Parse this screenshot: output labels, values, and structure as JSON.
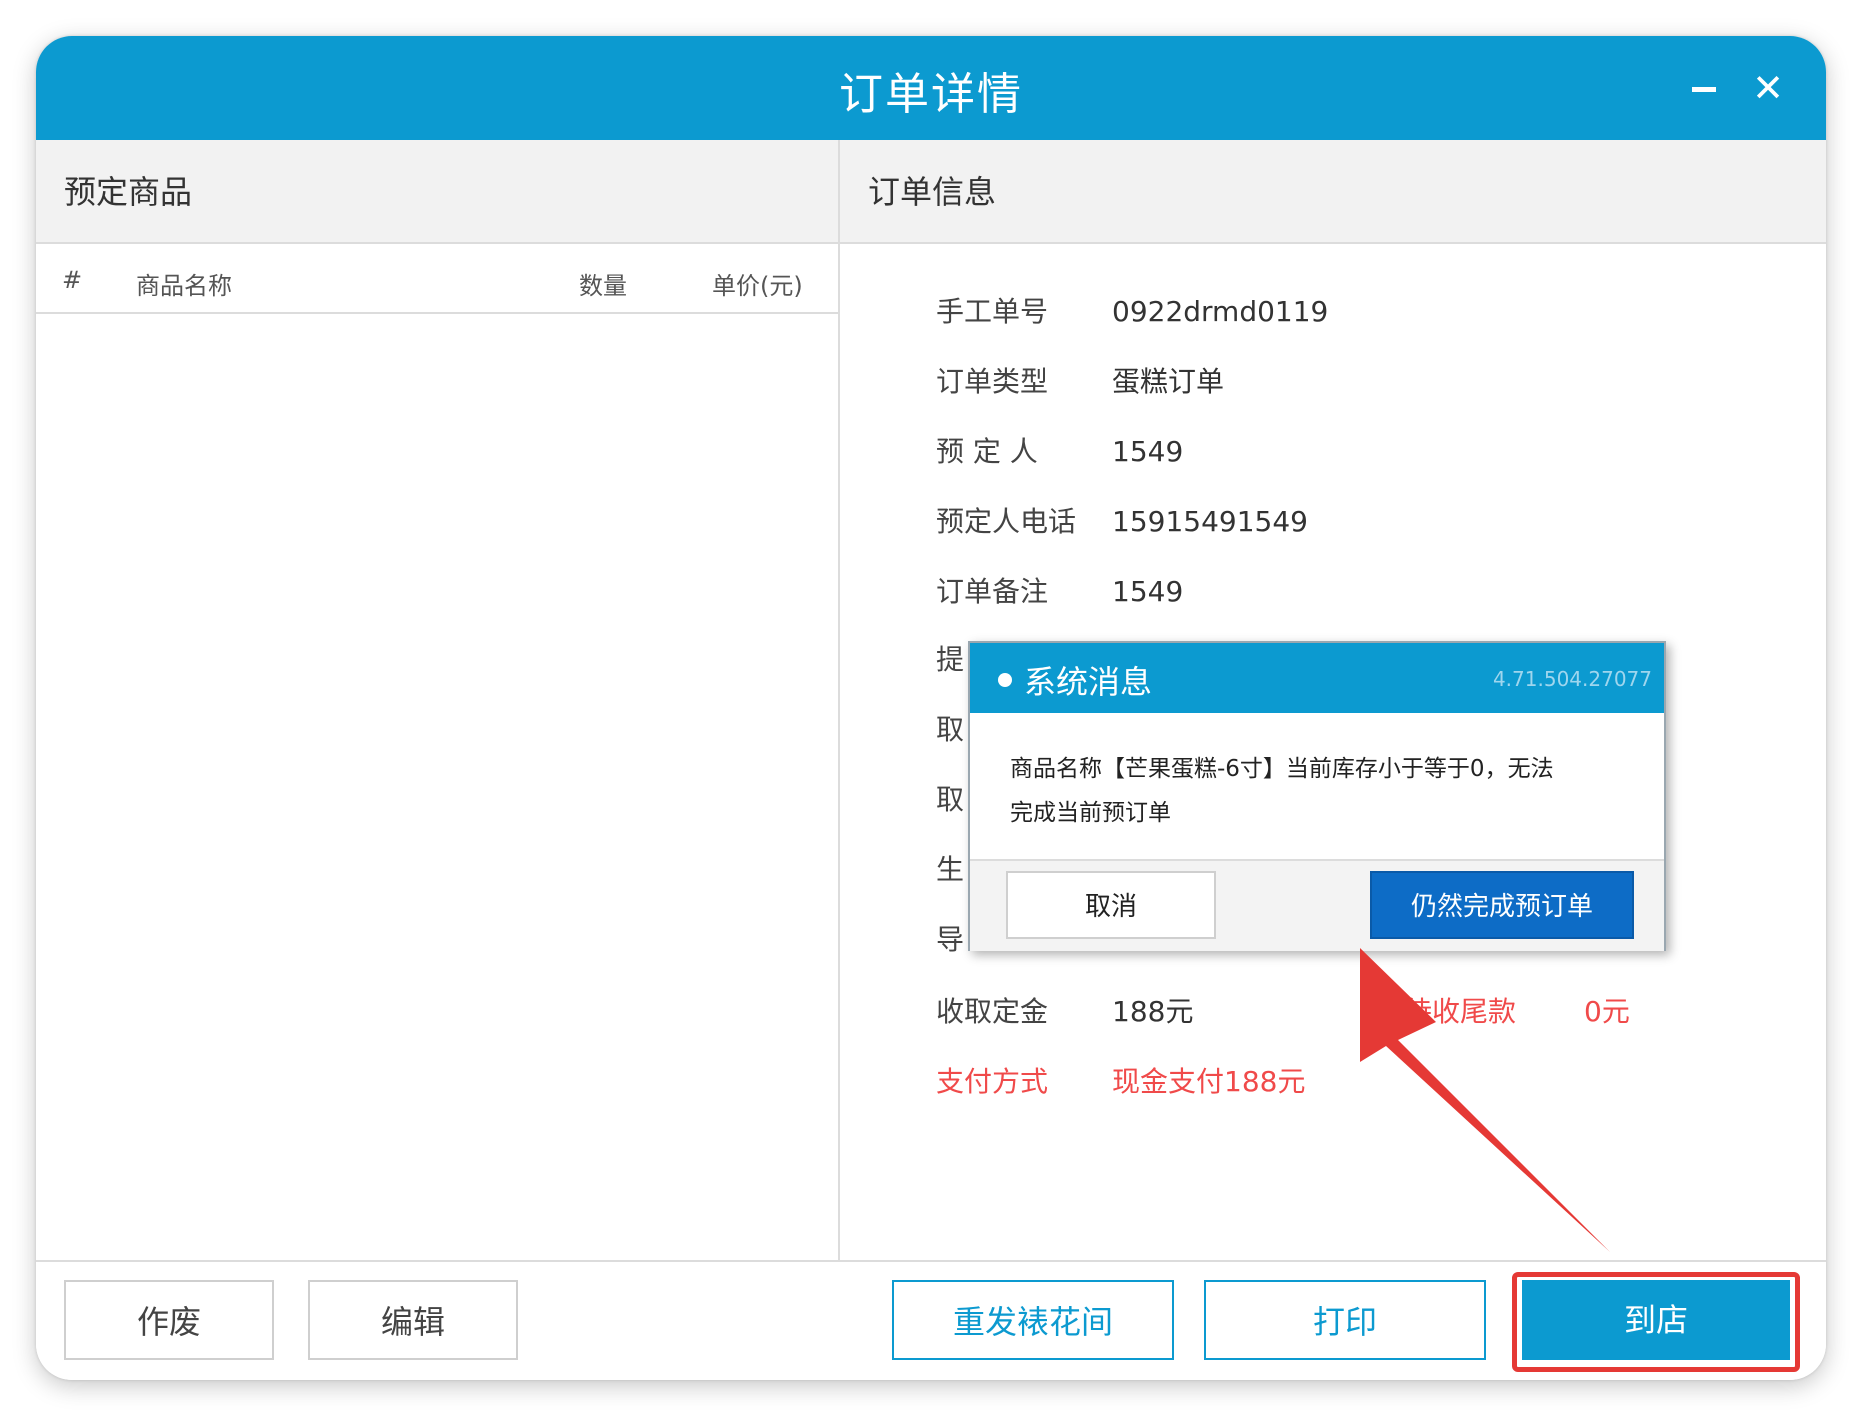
{
  "window": {
    "title": "订单详情",
    "minimize_icon": "minimize-icon",
    "close_glyph": "✕"
  },
  "left_panel": {
    "title": "预定商品",
    "columns": [
      "#",
      "商品名称",
      "数量",
      "单价(元)"
    ]
  },
  "right_panel": {
    "title": "订单信息",
    "rows": [
      {
        "label": "手工单号",
        "value": "0922drmd0119"
      },
      {
        "label": "订单类型",
        "value": "蛋糕订单"
      },
      {
        "label": "预 定 人",
        "value": "1549"
      },
      {
        "label": "预定人电话",
        "value": "15915491549"
      },
      {
        "label": "订单备注",
        "value": "1549"
      },
      {
        "label": "提",
        "value": ""
      },
      {
        "label": "取",
        "value": ""
      },
      {
        "label": "取",
        "value": ""
      },
      {
        "label": "生",
        "value": ""
      },
      {
        "label": "导",
        "value": ""
      },
      {
        "label": "收取定金",
        "value": "188元"
      },
      {
        "label": "支付方式",
        "value": "现金支付188元"
      }
    ],
    "balance": {
      "label": "待收尾款",
      "value": "0元"
    }
  },
  "footer": {
    "void_label": "作废",
    "edit_label": "编辑",
    "resend_label": "重发裱花间",
    "print_label": "打印",
    "arrive_label": "到店"
  },
  "dialog": {
    "title": "系统消息",
    "version": "4.71.504.27077",
    "message_line1": "商品名称【芒果蛋糕-6寸】当前库存小于等于0，无法",
    "message_line2": "完成当前预订单",
    "cancel_label": "取消",
    "confirm_label": "仍然完成预订单"
  },
  "colors": {
    "brand": "#0c9ad0",
    "danger": "#f04a4a",
    "dialog_button": "#0d6cc6",
    "highlight": "#e53935"
  }
}
